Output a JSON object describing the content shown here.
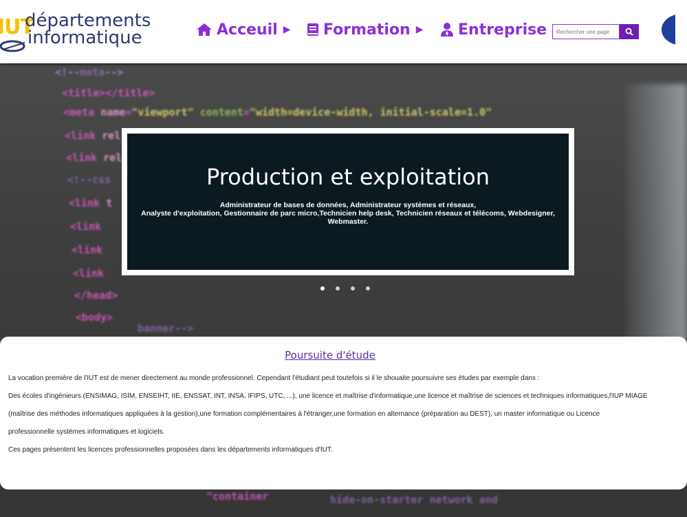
{
  "header": {
    "logo_prefix": "IUT",
    "logo_line1": "départements",
    "logo_line2": "informatique",
    "nav": [
      {
        "label": "Acceuil",
        "icon": "home-icon"
      },
      {
        "label": "Formation",
        "icon": "book-icon"
      },
      {
        "label": "Entreprise",
        "icon": "user-tie-icon"
      }
    ],
    "search_placeholder": "Rechercher une page",
    "language_flag": "france-flag-icon",
    "colors": {
      "accent": "#8e2fd6",
      "search_button": "#6a1fb3"
    }
  },
  "slider": {
    "title": "Production et exploitation",
    "text": "Administrateur de bases de données, Administrateur systèmes et réseaux,\nAnalyste d'exploitation, Gestionnaire de parc micro,Technicien help desk, Technicien réseaux et télécoms, Webdesigner,\nWebmaster.",
    "active_slide": 1,
    "slide_count": 4
  },
  "content": {
    "title": "Poursuite d'étude",
    "paragraphs": [
      "La vocation première de l'IUT est de mener directement au monde professionnel. Cependant l'étudiant peut toutefois si il le shouaite poursuivre ses études par exemple dans :",
      "Des écoles d'ingénieurs (ENSIMAG, ISIM, ENSEIHT, IIE, ENSSAT, INT, INSA, IFIPS, UTC, ...), une licence et maîtrise d'informatique,une licence et maîtrise de sciences et techniques informatiques,l'IUP MIAGE",
      "(maîtrise des méthodes informatiques appliquées à la gestion),une formation complémentaires à l'étranger,une formation en alternance (préparation au DEST), un master informatique ou Licence",
      "professionnelle systèmes informatiques et logiciels.",
      "Ces pages présentent les licences professionnelles  proposées dans les départements informatiques d'IUT."
    ]
  }
}
